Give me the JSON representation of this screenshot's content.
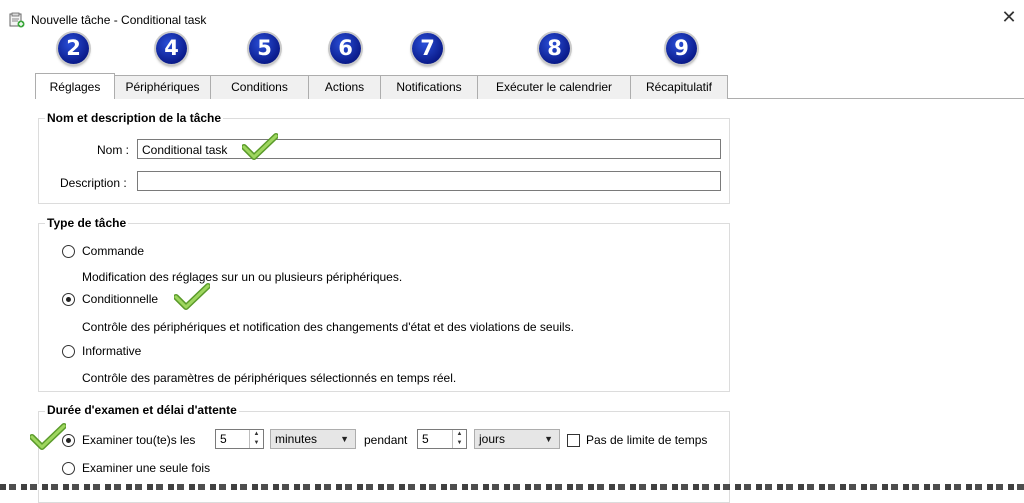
{
  "window": {
    "title": "Nouvelle tâche - Conditional task",
    "close_icon": "close-icon",
    "app_icon": "task-icon"
  },
  "badges": [
    "2",
    "4",
    "5",
    "6",
    "7",
    "8",
    "9"
  ],
  "tabs": [
    {
      "label": "Réglages",
      "active": true
    },
    {
      "label": "Périphériques",
      "active": false
    },
    {
      "label": "Conditions",
      "active": false
    },
    {
      "label": "Actions",
      "active": false
    },
    {
      "label": "Notifications",
      "active": false
    },
    {
      "label": "Exécuter le calendrier",
      "active": false
    },
    {
      "label": "Récapitulatif",
      "active": false
    }
  ],
  "name_group": {
    "title": "Nom et description de la tâche",
    "name_label": "Nom :",
    "name_value": "Conditional task",
    "description_label": "Description :",
    "description_value": ""
  },
  "type_group": {
    "title": "Type de tâche",
    "options": [
      {
        "label": "Commande",
        "description": "Modification des réglages sur un ou plusieurs périphériques.",
        "selected": false
      },
      {
        "label": "Conditionnelle",
        "description": "Contrôle des périphériques et notification des changements d'état et des violations de seuils.",
        "selected": true
      },
      {
        "label": "Informative",
        "description": "Contrôle des paramètres de périphériques sélectionnés en temps réel.",
        "selected": false
      }
    ]
  },
  "duration_group": {
    "title": "Durée d'examen et délai d'attente",
    "examine_label": "Examiner tou(te)s les",
    "interval_value": "5",
    "interval_unit": "minutes",
    "during_label": "pendant",
    "duration_value": "5",
    "duration_unit": "jours",
    "no_limit_label": "Pas de limite de temps",
    "no_limit_checked": false,
    "once_label": "Examiner une seule fois",
    "periodic_selected": true
  },
  "colors": {
    "badge": "#0b1c8c",
    "checkmark": "#7bc142",
    "tab_border": "#adadad"
  }
}
